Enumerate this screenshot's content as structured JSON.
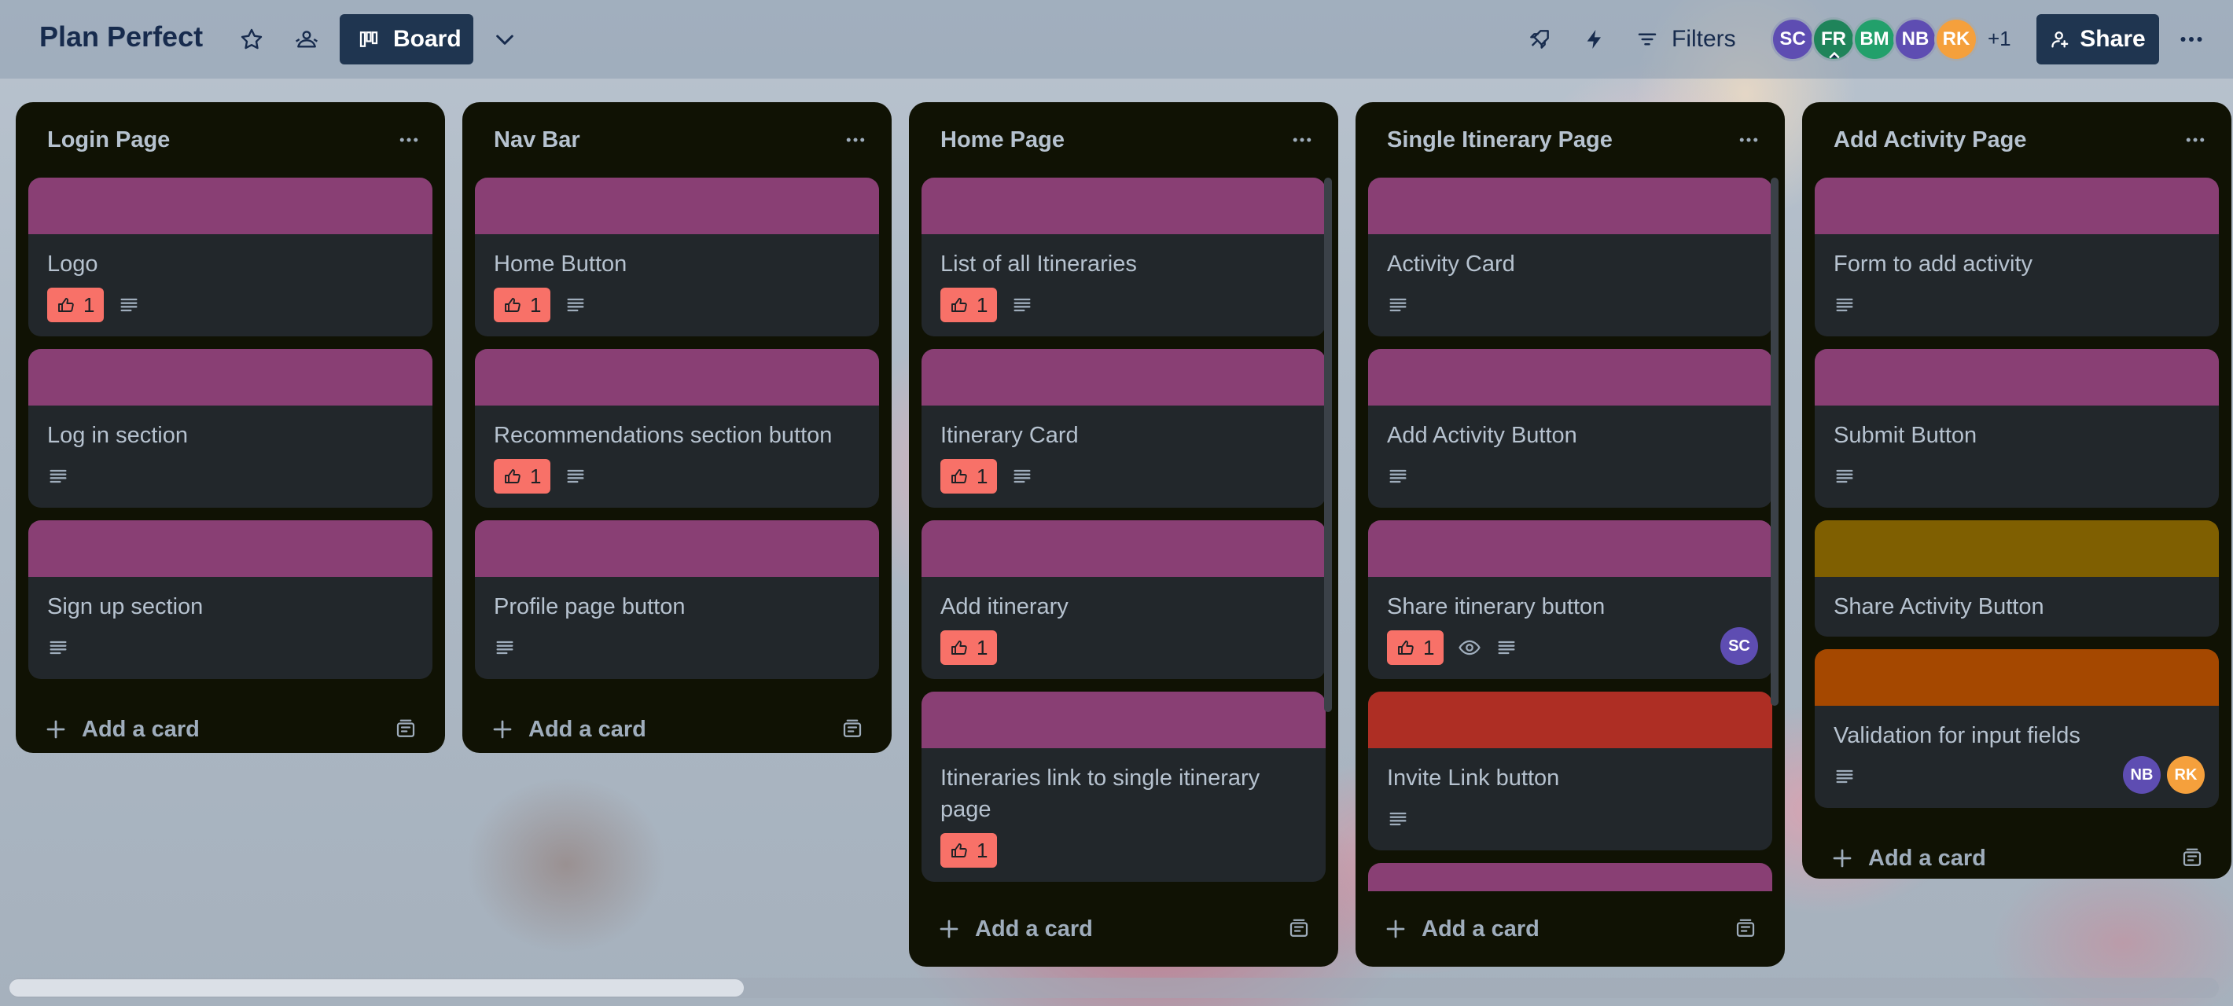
{
  "header": {
    "board_name": "Plan Perfect",
    "view_label": "Board",
    "filters_label": "Filters",
    "share_label": "Share",
    "more_members": "+1",
    "members": [
      {
        "initials": "SC",
        "color": "#5e4db2"
      },
      {
        "initials": "FR",
        "color": "#1f845a"
      },
      {
        "initials": "BM",
        "color": "#22a06b"
      },
      {
        "initials": "NB",
        "color": "#5e4db2"
      },
      {
        "initials": "RK",
        "color": "#f5a03c"
      }
    ]
  },
  "colors": {
    "label_magenta": "#893f74",
    "label_olive": "#7f5f01",
    "label_orange": "#a54800",
    "label_red": "#ae2e24",
    "vote_badge": "#f87168",
    "list_bg": "#101204",
    "card_bg": "#22272b"
  },
  "lists": [
    {
      "title": "Login Page",
      "add_card": "Add a card",
      "cards": [
        {
          "title": "Logo",
          "votes": "1"
        },
        {
          "title": "Log in section"
        },
        {
          "title": "Sign up section"
        }
      ]
    },
    {
      "title": "Nav Bar",
      "add_card": "Add a card",
      "cards": [
        {
          "title": "Home Button",
          "votes": "1"
        },
        {
          "title": "Recommendations section button",
          "votes": "1"
        },
        {
          "title": "Profile page button"
        }
      ]
    },
    {
      "title": "Home Page",
      "add_card": "Add a card",
      "cards": [
        {
          "title": "List of all Itineraries",
          "votes": "1"
        },
        {
          "title": "Itinerary Card",
          "votes": "1"
        },
        {
          "title": "Add itinerary",
          "votes": "1"
        },
        {
          "title": "Itineraries link to single itinerary page",
          "votes": "1"
        }
      ]
    },
    {
      "title": "Single Itinerary Page",
      "add_card": "Add a card",
      "cards": [
        {
          "title": "Activity Card"
        },
        {
          "title": "Add Activity Button"
        },
        {
          "title": "Share itinerary button",
          "votes": "1",
          "member": "SC"
        },
        {
          "title": "Invite Link button"
        }
      ]
    },
    {
      "title": "Add Activity Page",
      "add_card": "Add a card",
      "cards": [
        {
          "title": "Form to add activity"
        },
        {
          "title": "Submit Button"
        },
        {
          "title": "Share Activity Button"
        },
        {
          "title": "Validation for input fields",
          "members": [
            "NB",
            "RK"
          ]
        }
      ]
    }
  ]
}
